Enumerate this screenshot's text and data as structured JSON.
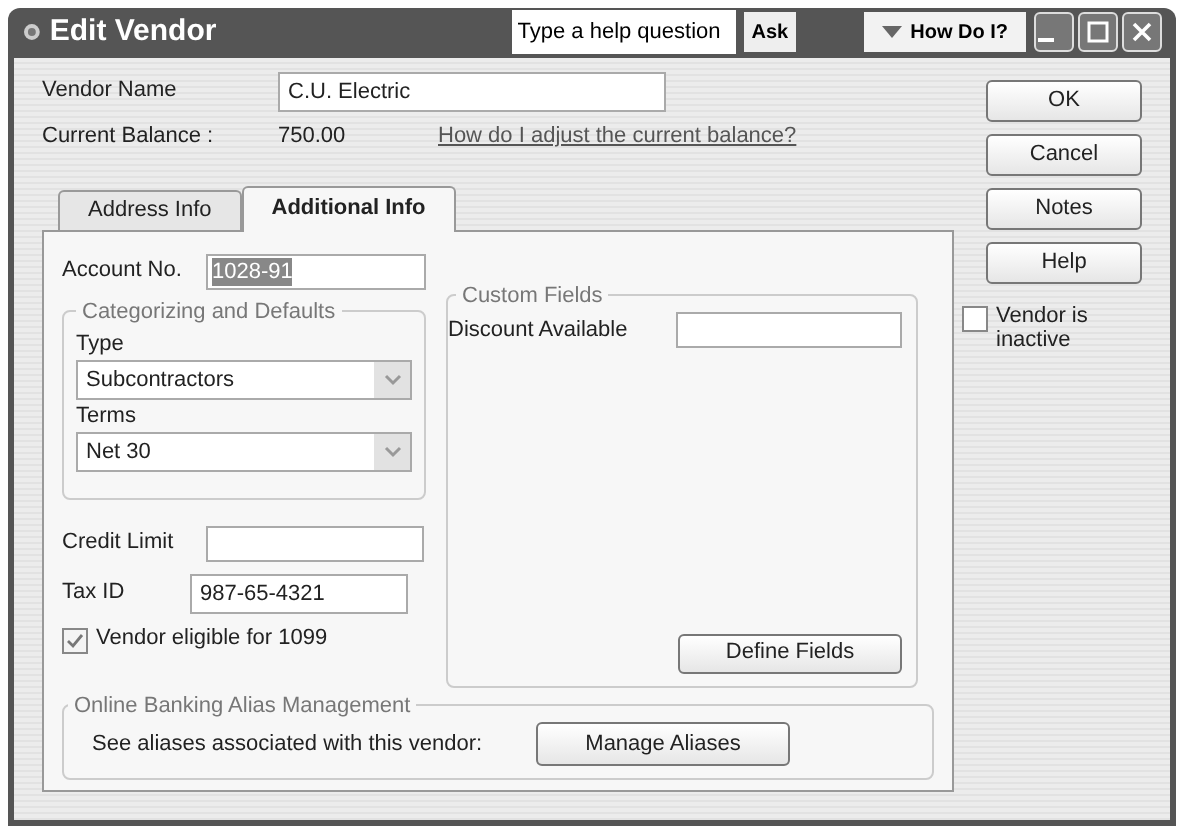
{
  "window": {
    "title": "Edit Vendor"
  },
  "help": {
    "placeholder": "Type a help question",
    "ask_label": "Ask",
    "how_do_i_label": "How Do I?"
  },
  "vendor_name": {
    "label": "Vendor Name",
    "value": "C.U. Electric"
  },
  "current_balance": {
    "label": "Current Balance :",
    "value": "750.00",
    "link": "How do I adjust the current balance?"
  },
  "tabs": [
    {
      "label": "Address Info",
      "selected": false
    },
    {
      "label": "Additional Info",
      "selected": true
    }
  ],
  "account_no": {
    "label": "Account No.",
    "value": "1028-91",
    "highlighted": true
  },
  "categorizing": {
    "title": "Categorizing and Defaults",
    "fields": [
      {
        "label": "Type",
        "value": "Subcontractors"
      },
      {
        "label": "Terms",
        "value": "Net 30"
      }
    ]
  },
  "credit_limit": {
    "label": "Credit Limit"
  },
  "tax_id": {
    "label": "Tax ID",
    "value": "987-65-4321"
  },
  "eligible_1099": {
    "label": "Vendor eligible for 1099",
    "checked": true
  },
  "custom_fields": {
    "title": "Custom Fields",
    "fields": [
      {
        "label": "Discount Available"
      }
    ],
    "button": "Define Fields"
  },
  "online_banking": {
    "title": "Online Banking Alias Management",
    "text": "See aliases associated with this vendor:",
    "button": "Manage Aliases"
  },
  "buttons": [
    "OK",
    "Cancel",
    "Notes",
    "Help"
  ],
  "inactive": {
    "label": "Vendor is inactive",
    "checked": false
  }
}
